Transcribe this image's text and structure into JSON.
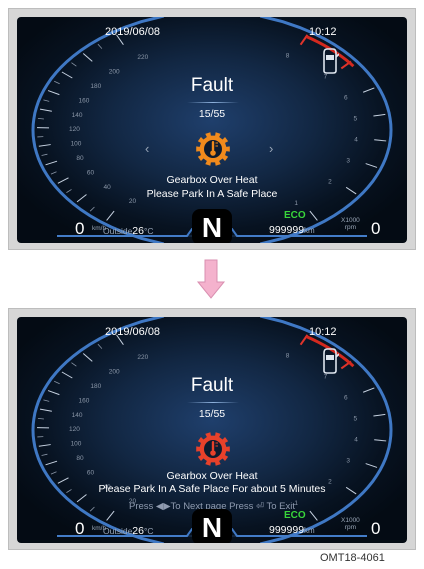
{
  "screens": [
    {
      "date": "2019/06/08",
      "time": "10:12",
      "title": "Fault",
      "page": "15/55",
      "prev_icon": "chevron-left-icon",
      "next_icon": "chevron-right-icon",
      "warning_icon": "gear-temperature-icon",
      "warning_color": "#f08a1c",
      "messages": [
        "Gearbox Over Heat",
        "Please Park In A Safe Place"
      ],
      "hint": "",
      "eco": "ECO",
      "odometer": "999999",
      "odometer_unit": "km",
      "outside_label": "Outside",
      "outside_temp": "26",
      "outside_unit": "°C",
      "speed_zero": "0",
      "speed_unit": "km/h",
      "rpm_zero": "0",
      "rpm_unit_line1": "X1000",
      "rpm_unit_line2": "rpm",
      "gear": "N",
      "speed_ticks": [
        "20",
        "40",
        "60",
        "80",
        "100",
        "120",
        "140",
        "160",
        "180",
        "200",
        "220"
      ],
      "rpm_ticks": [
        "1",
        "2",
        "3",
        "4",
        "5",
        "6",
        "7",
        "8"
      ]
    },
    {
      "date": "2019/06/08",
      "time": "10:12",
      "title": "Fault",
      "page": "15/55",
      "prev_icon": "",
      "next_icon": "",
      "warning_icon": "gear-temperature-icon",
      "warning_color": "#e8412a",
      "messages": [
        "Gearbox Over Heat",
        "Please Park In A Safe Place For about 5 Minutes"
      ],
      "hint": "Press ◀▶To Next page   Press ⏎ To Exit",
      "eco": "ECO",
      "odometer": "999999",
      "odometer_unit": "km",
      "outside_label": "Outside",
      "outside_temp": "26",
      "outside_unit": "°C",
      "speed_zero": "0",
      "speed_unit": "km/h",
      "rpm_zero": "0",
      "rpm_unit_line1": "X1000",
      "rpm_unit_line2": "rpm",
      "gear": "N",
      "speed_ticks": [
        "20",
        "40",
        "60",
        "80",
        "100",
        "120",
        "140",
        "160",
        "180",
        "200",
        "220"
      ],
      "rpm_ticks": [
        "1",
        "2",
        "3",
        "4",
        "5",
        "6",
        "7",
        "8"
      ]
    }
  ],
  "transition_icon": "arrow-down-icon",
  "transition_color": "#f2a7c6",
  "caption": "OMT18-4061"
}
